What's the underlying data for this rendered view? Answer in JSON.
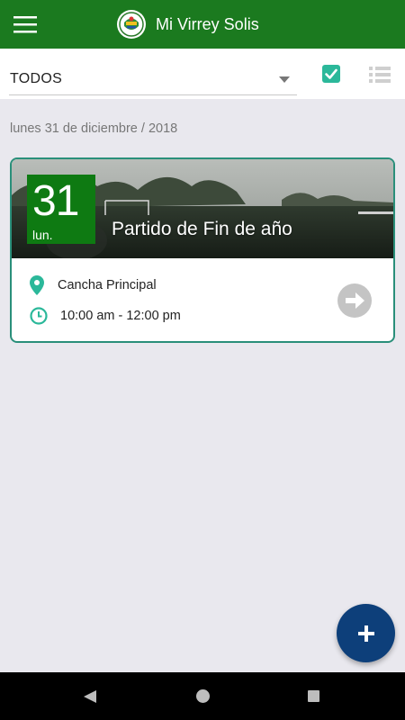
{
  "app": {
    "title": "Mi Virrey Solis",
    "colors": {
      "appbar": "#1b7a1f",
      "accent": "#2bb89a",
      "fab": "#0d3f7a",
      "badge": "#0e7a12"
    }
  },
  "filter": {
    "selected": "TODOS",
    "icons": [
      "checkbox-checked-icon",
      "list-view-icon"
    ]
  },
  "date_header": "lunes 31 de diciembre / 2018",
  "event": {
    "day": "31",
    "day_abbr": "lun.",
    "title": "Partido de Fin de año",
    "location": "Cancha Principal",
    "time": "10:00 am - 12:00 pm"
  },
  "fab": {
    "icon": "plus-icon"
  },
  "system_nav": [
    "back",
    "home",
    "recents"
  ]
}
